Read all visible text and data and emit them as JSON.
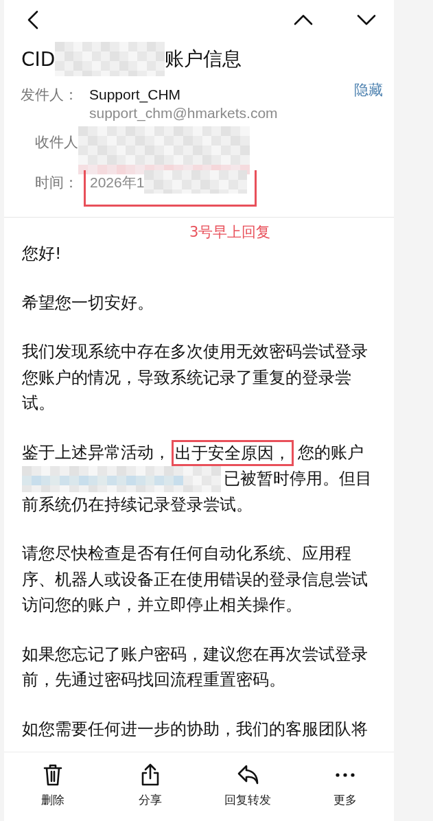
{
  "title": {
    "prefix": "CID",
    "suffix": "账户信息"
  },
  "header": {
    "hide_link": "隐藏",
    "fields": [
      {
        "kind": "sender",
        "label": "发件人：",
        "name": "Support_CHM",
        "email": "support_chm@hmarkets.com"
      },
      {
        "kind": "recipient",
        "label": "收件人"
      },
      {
        "kind": "time",
        "label": "时间：",
        "value": "2026年1"
      }
    ]
  },
  "annotation": "3号早上回复",
  "paragraphs": [
    {
      "kind": "text",
      "text": "您好!"
    },
    {
      "kind": "text",
      "text": "希望您一切安好。"
    },
    {
      "kind": "text",
      "text": "我们发现系统中存在多次使用无效密码尝试登录您账户的情况，导致系统记录了重复的登录尝试。"
    },
    {
      "kind": "redacted",
      "before": "鉴于上述异常活动，",
      "highlight": "出于安全原因，",
      "middle": "您的账户",
      "after": "已被暂时停用。但目",
      "continuation": "前系统仍在持续记录登录尝试。"
    },
    {
      "kind": "text",
      "text": "请您尽快检查是否有任何自动化系统、应用程序、机器人或设备正在使用错误的登录信息尝试访问您的账户，并立即停止相关操作。"
    },
    {
      "kind": "text",
      "text": "如果您忘记了账户密码，建议您在再次尝试登录前，先通过密码找回流程重置密码。"
    },
    {
      "kind": "text",
      "text": "如您需要任何进一步的协助，我们的客服团队将"
    }
  ],
  "toolbar": [
    {
      "kind": "delete",
      "label": "删除"
    },
    {
      "kind": "share",
      "label": "分享"
    },
    {
      "kind": "reply",
      "label": "回复转发"
    },
    {
      "kind": "more",
      "label": "更多"
    }
  ]
}
